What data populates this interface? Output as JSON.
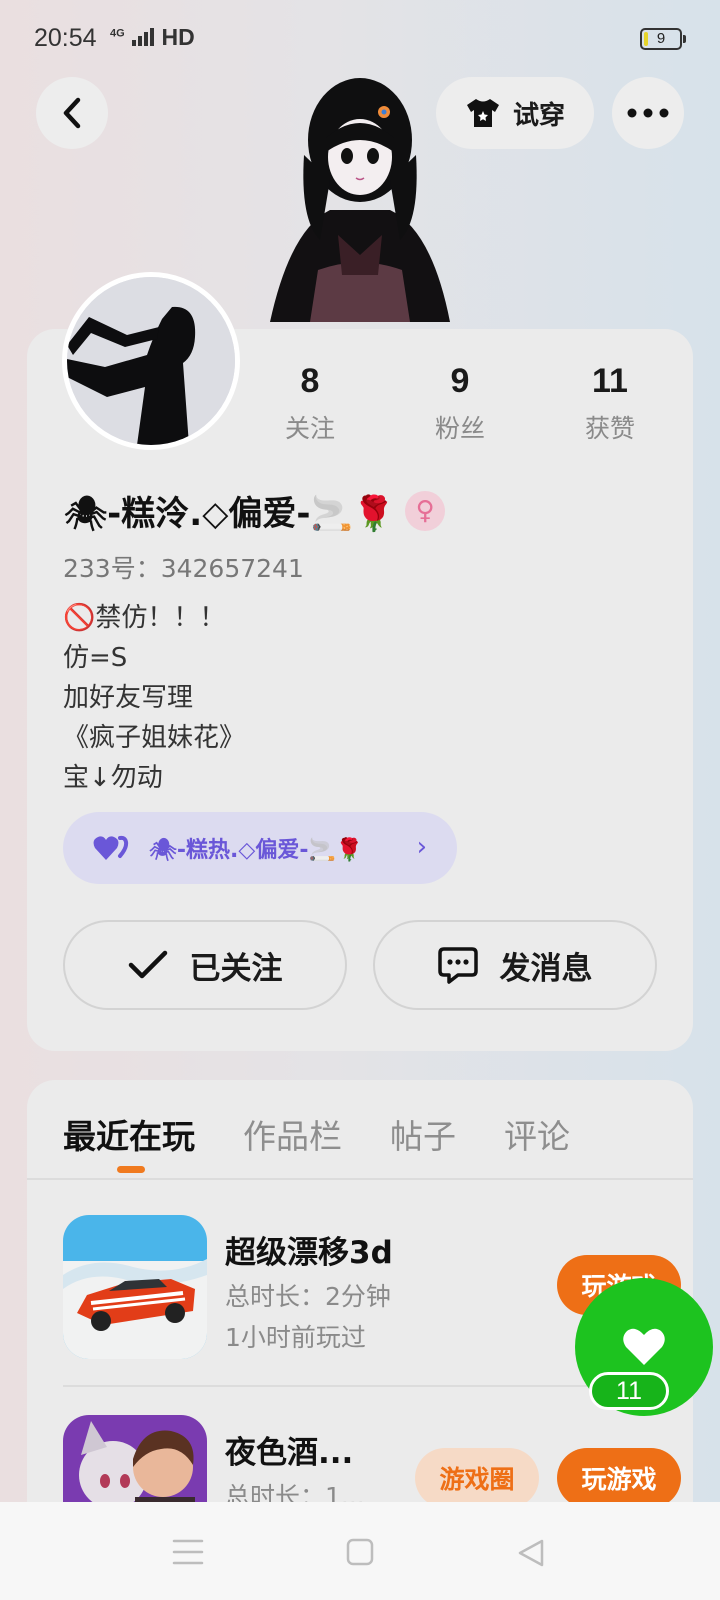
{
  "status": {
    "time": "20:54",
    "network": "4G",
    "hd": "HD",
    "battery": "9",
    "battery_level": 0.12
  },
  "header": {
    "tryon_label": "试穿"
  },
  "profile": {
    "stats": [
      {
        "value": "8",
        "label": "关注"
      },
      {
        "value": "9",
        "label": "粉丝"
      },
      {
        "value": "11",
        "label": "获赞"
      }
    ],
    "name": "🕷-糕泠.◇偏爱-🚬🌹",
    "gender": "♀",
    "id_line": "233号：342657241",
    "bio": [
      "🚫禁仿！！！",
      "仿=S",
      "加好友写理",
      "《疯子姐妹花》",
      "宝↓勿动"
    ],
    "cp_tag": "🕷-糕热.◇偏爱-🚬🌹",
    "follow_label": "已关注",
    "message_label": "发消息"
  },
  "tabs": [
    "最近在玩",
    "作品栏",
    "帖子",
    "评论"
  ],
  "games": [
    {
      "title": "超级漂移3d",
      "duration": "总时长：2分钟",
      "last_played": "1小时前玩过",
      "play_label": "玩游戏"
    },
    {
      "title": "夜色酒...",
      "duration": "总时长：1...",
      "circle_label": "游戏圈",
      "play_label": "玩游戏"
    }
  ],
  "like": {
    "count": "11"
  },
  "colors": {
    "accent": "#ee6f16",
    "like_green": "#1dc31f",
    "cp_purple": "#6a57d8"
  }
}
